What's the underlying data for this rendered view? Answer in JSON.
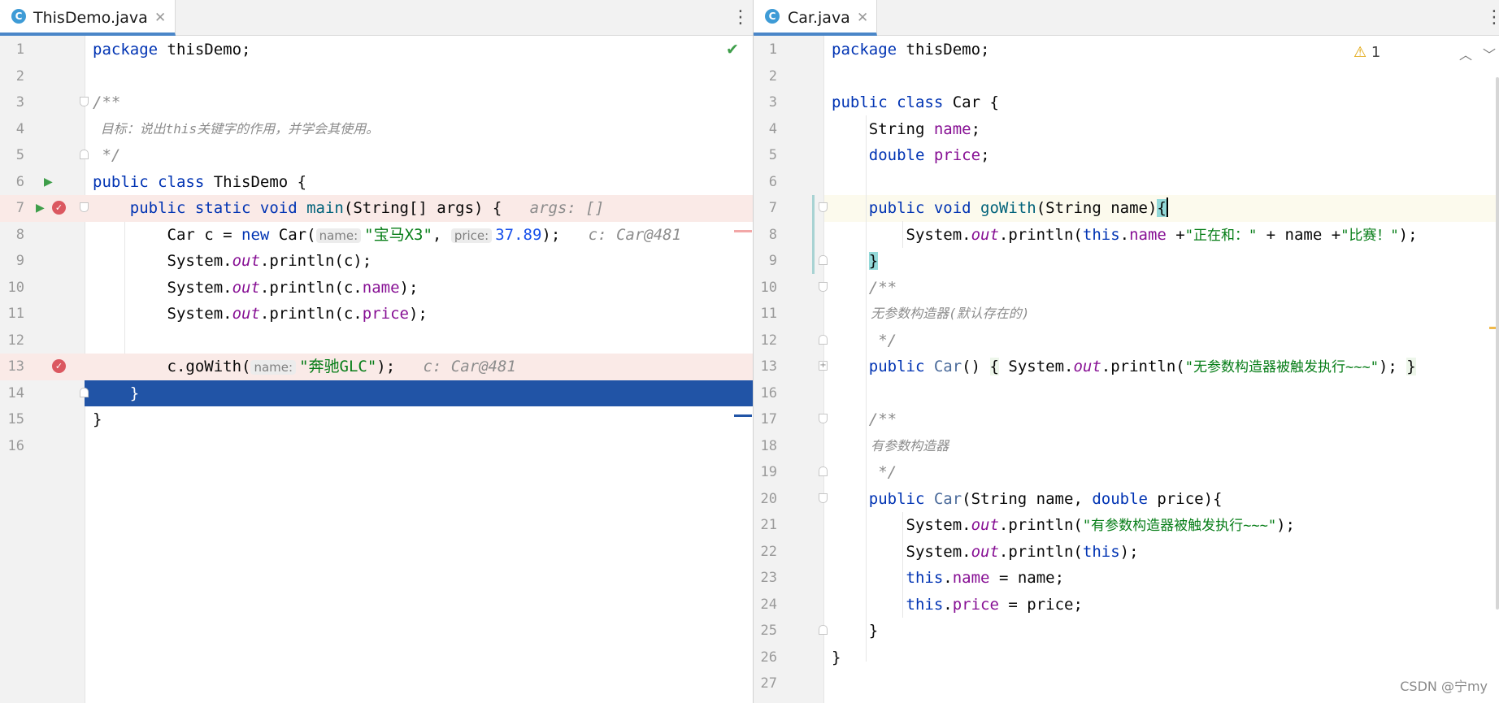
{
  "left": {
    "tab": {
      "icon": "C",
      "title": "ThisDemo.java",
      "close": "✕",
      "menu": "⋮"
    },
    "status": {
      "check_icon": "✔"
    },
    "lines": [
      {
        "n": "1"
      },
      {
        "n": "2"
      },
      {
        "n": "3"
      },
      {
        "n": "4"
      },
      {
        "n": "5"
      },
      {
        "n": "6"
      },
      {
        "n": "7"
      },
      {
        "n": "8"
      },
      {
        "n": "9"
      },
      {
        "n": "10"
      },
      {
        "n": "11"
      },
      {
        "n": "12"
      },
      {
        "n": "13"
      },
      {
        "n": "14"
      },
      {
        "n": "15"
      },
      {
        "n": "16"
      }
    ],
    "code": {
      "l1_kw": "package",
      "l1_rest": " thisDemo;",
      "l3": "/**",
      "l4": " 目标：说出this关键字的作用，并学会其使用。",
      "l5": " */",
      "l6_kw": "public class",
      "l6_rest": " ThisDemo {",
      "l7_indent": "    ",
      "l7_kw": "public static void",
      "l7_m": " main",
      "l7_rest": "(String[] args) {",
      "l7_hint": "args: []",
      "l8_a": "        Car c = ",
      "l8_kw": "new",
      "l8_b": " Car(",
      "l8_h1": "name:",
      "l8_s": "\"宝马X3\"",
      "l8_c": ", ",
      "l8_h2": "price:",
      "l8_num": "37.89",
      "l8_d": ");",
      "l8_hint": "c: Car@481",
      "l9_a": "        System.",
      "l9_out": "out",
      "l9_b": ".println(c);",
      "l10_a": "        System.",
      "l10_out": "out",
      "l10_b": ".println(c.",
      "l10_f": "name",
      "l10_c": ");",
      "l11_a": "        System.",
      "l11_out": "out",
      "l11_b": ".println(c.",
      "l11_f": "price",
      "l11_c": ");",
      "l13_a": "        c.goWith(",
      "l13_h": "name:",
      "l13_s": "\"奔驰GLC\"",
      "l13_b": ");",
      "l13_hint": "c: Car@481",
      "l14": "    }",
      "l15": "}"
    }
  },
  "right": {
    "tab": {
      "icon": "C",
      "title": "Car.java",
      "close": "✕",
      "menu": "⋮"
    },
    "status": {
      "warning_icon": "⚠",
      "warning_count": "1",
      "up_icon": "︿",
      "down_icon": "﹀"
    },
    "lines": [
      {
        "n": "1"
      },
      {
        "n": "2"
      },
      {
        "n": "3"
      },
      {
        "n": "4"
      },
      {
        "n": "5"
      },
      {
        "n": "6"
      },
      {
        "n": "7"
      },
      {
        "n": "8"
      },
      {
        "n": "9"
      },
      {
        "n": "10"
      },
      {
        "n": "11"
      },
      {
        "n": "12"
      },
      {
        "n": "13"
      },
      {
        "n": "16"
      },
      {
        "n": "17"
      },
      {
        "n": "18"
      },
      {
        "n": "19"
      },
      {
        "n": "20"
      },
      {
        "n": "21"
      },
      {
        "n": "22"
      },
      {
        "n": "23"
      },
      {
        "n": "24"
      },
      {
        "n": "25"
      },
      {
        "n": "26"
      },
      {
        "n": "27"
      }
    ],
    "code": {
      "r1_kw": "package",
      "r1_rest": " thisDemo;",
      "r3_kw": "public class",
      "r3_rest": " Car {",
      "r4_a": "    String ",
      "r4_f": "name",
      "r4_b": ";",
      "r5_a": "    ",
      "r5_kw": "double",
      "r5_sp": " ",
      "r5_f": "price",
      "r5_b": ";",
      "r7_a": "    ",
      "r7_kw": "public void",
      "r7_m": " goWith",
      "r7_b": "(String name)",
      "r7_brace": "{",
      "r8_a": "        System.",
      "r8_out": "out",
      "r8_b": ".println(",
      "r8_kw": "this",
      "r8_c": ".",
      "r8_f": "name",
      "r8_d": " +",
      "r8_s1": "\"正在和：\"",
      "r8_e": " + name +",
      "r8_s2": "\"比赛！\"",
      "r8_g": ");",
      "r9_a": "    ",
      "r9_brace": "}",
      "r10": "    /**",
      "r11": "     无参数构造器(默认存在的)",
      "r12": "     */",
      "r13_a": "    ",
      "r13_kw": "public",
      "r13_m": " Car",
      "r13_b": "() ",
      "r13_lb": "{",
      "r13_c": " System.",
      "r13_out": "out",
      "r13_d": ".println(",
      "r13_s": "\"无参数构造器被触发执行~~~\"",
      "r13_e": "); ",
      "r13_rb": "}",
      "r17": "    /**",
      "r18": "     有参数构造器",
      "r19": "     */",
      "r20_a": "    ",
      "r20_kw": "public",
      "r20_m": " Car",
      "r20_b": "(String name, ",
      "r20_kw2": "double",
      "r20_c": " price){",
      "r21_a": "        System.",
      "r21_out": "out",
      "r21_b": ".println(",
      "r21_s": "\"有参数构造器被触发执行~~~\"",
      "r21_c": ");",
      "r22_a": "        System.",
      "r22_out": "out",
      "r22_b": ".println(",
      "r22_kw": "this",
      "r22_c": ");",
      "r23_a": "        ",
      "r23_kw": "this",
      "r23_b": ".",
      "r23_f": "name",
      "r23_c": " = name;",
      "r24_a": "        ",
      "r24_kw": "this",
      "r24_b": ".",
      "r24_f": "price",
      "r24_c": " = price;",
      "r25": "    }",
      "r26": "}"
    },
    "watermark": "CSDN @宁my"
  },
  "colors": {
    "keyword": "#0033b3",
    "string": "#067d17",
    "number": "#1750eb",
    "field": "#871094",
    "comment": "#8c8c8c",
    "method": "#00627a",
    "execution_line": "#2154a6",
    "breakpoint_line": "#faeae7",
    "breakpoint": "#db5860",
    "run": "#3e9e4a"
  }
}
